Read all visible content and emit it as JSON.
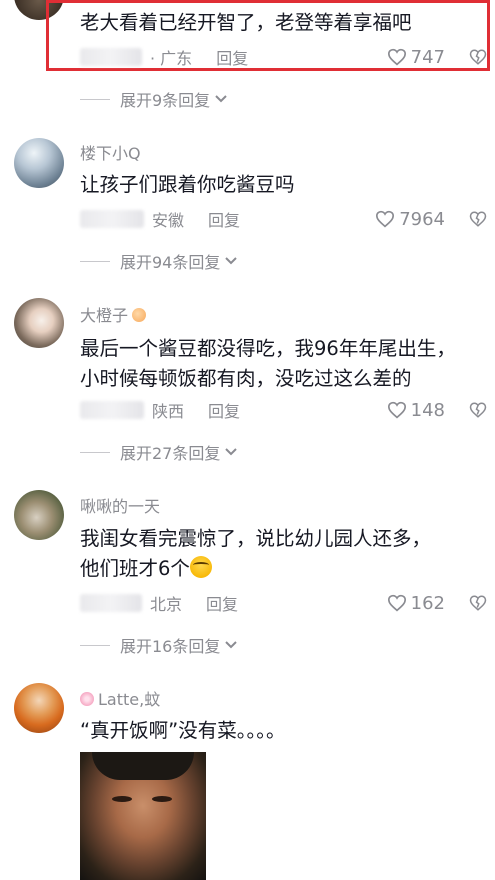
{
  "comments": [
    {
      "text_lines": [
        "老大看着已经开智了，老登等着享福吧"
      ],
      "location": "· 广东",
      "reply_label": "回复",
      "likes": "747",
      "expand_label": "展开9条回复"
    },
    {
      "username": "楼下小Q",
      "text_lines": [
        "让孩子们跟着你吃酱豆吗"
      ],
      "location": "安徽",
      "reply_label": "回复",
      "likes": "7964",
      "expand_label": "展开94条回复"
    },
    {
      "username": "大橙子",
      "text_lines": [
        "最后一个酱豆都没得吃，我96年年尾出生，",
        "小时候每顿饭都有肉，没吃过这么差的"
      ],
      "location": "陕西",
      "reply_label": "回复",
      "likes": "148",
      "expand_label": "展开27条回复"
    },
    {
      "username": "啾啾的一天",
      "text_lines": [
        "我闺女看完震惊了，说比幼儿园人还多，",
        "他们班才6个"
      ],
      "location": "北京",
      "reply_label": "回复",
      "likes": "162",
      "expand_label": "展开16条回复"
    },
    {
      "username": "Latte,蚊",
      "text_lines": [
        "“真开饭啊”没有菜。。。。"
      ]
    }
  ]
}
